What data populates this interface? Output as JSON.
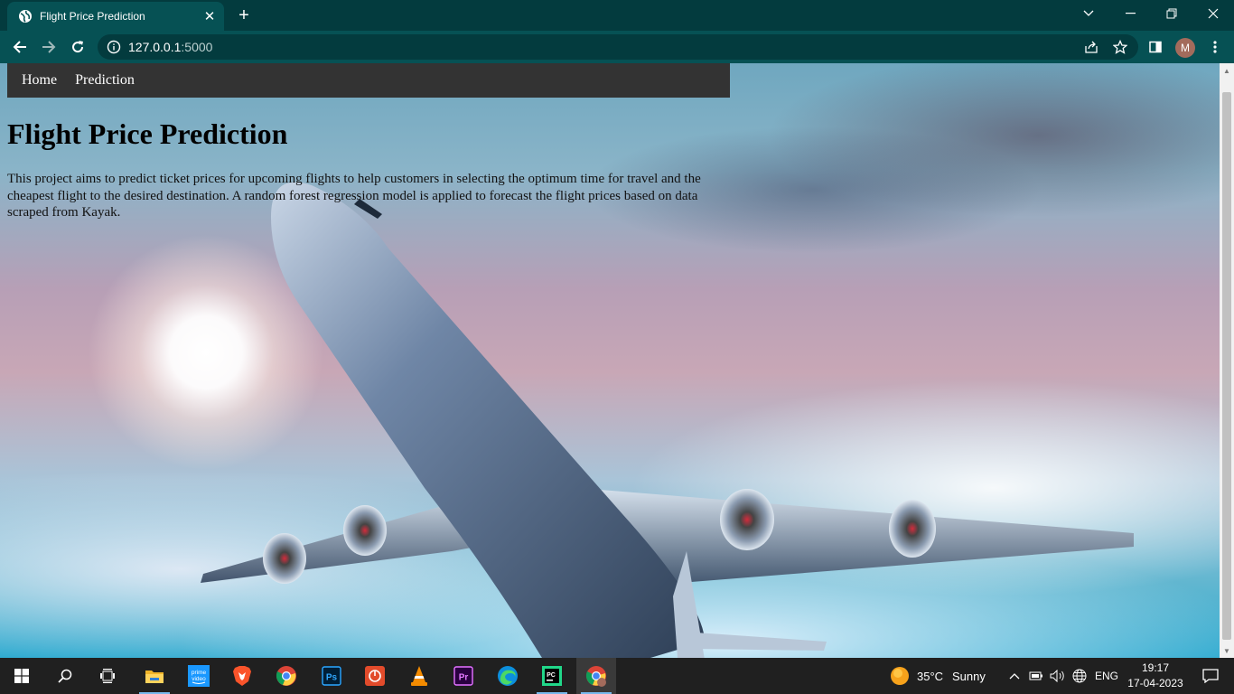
{
  "browser": {
    "tab_title": "Flight Price Prediction",
    "url_host": "127.0.0.1",
    "url_port": ":5000"
  },
  "page": {
    "nav": [
      "Home",
      "Prediction"
    ],
    "heading": "Flight Price Prediction",
    "description": "This project aims to predict ticket prices for upcoming flights to help customers in selecting the optimum time for travel and the cheapest flight to the desired destination. A random forest regression model is applied to forecast the flight prices based on data scraped from Kayak."
  },
  "profile": {
    "initial": "M"
  },
  "taskbar": {
    "apps": [
      "windows-start",
      "search",
      "task-view",
      "file-explorer",
      "prime-video",
      "brave",
      "chrome",
      "photoshop",
      "power-app",
      "vlc",
      "premiere-pro",
      "edge",
      "pycharm",
      "chrome-active"
    ],
    "prime_label_1": "prime",
    "prime_label_2": "video",
    "ps_label": "Ps",
    "pr_label": "Pr",
    "pc_label": "PC",
    "weather_temp": "35°C",
    "weather_desc": "Sunny",
    "language": "ENG",
    "time": "19:17",
    "date": "17-04-2023"
  },
  "colors": {
    "titlebar": "#033b3e",
    "toolbar": "#065154",
    "navbar": "#333333",
    "taskbar": "#202020"
  }
}
